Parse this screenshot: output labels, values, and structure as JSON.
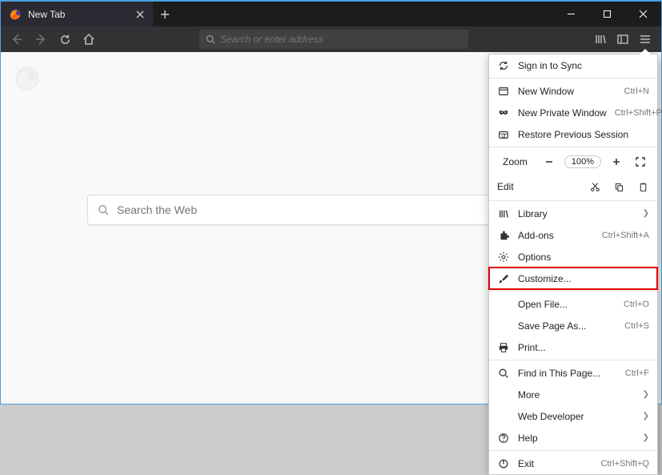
{
  "tab": {
    "title": "New Tab"
  },
  "urlbar": {
    "placeholder": "Search or enter address"
  },
  "search": {
    "placeholder": "Search the Web"
  },
  "menu": {
    "sign_in": "Sign in to Sync",
    "new_window": {
      "label": "New Window",
      "shortcut": "Ctrl+N"
    },
    "new_private": {
      "label": "New Private Window",
      "shortcut": "Ctrl+Shift+P"
    },
    "restore": "Restore Previous Session",
    "zoom_label": "Zoom",
    "zoom_value": "100%",
    "edit_label": "Edit",
    "library": "Library",
    "addons": {
      "label": "Add-ons",
      "shortcut": "Ctrl+Shift+A"
    },
    "options": "Options",
    "customize": "Customize...",
    "open_file": {
      "label": "Open File...",
      "shortcut": "Ctrl+O"
    },
    "save_page": {
      "label": "Save Page As...",
      "shortcut": "Ctrl+S"
    },
    "print": "Print...",
    "find": {
      "label": "Find in This Page...",
      "shortcut": "Ctrl+F"
    },
    "more": "More",
    "webdev": "Web Developer",
    "help": "Help",
    "exit": {
      "label": "Exit",
      "shortcut": "Ctrl+Shift+Q"
    }
  }
}
